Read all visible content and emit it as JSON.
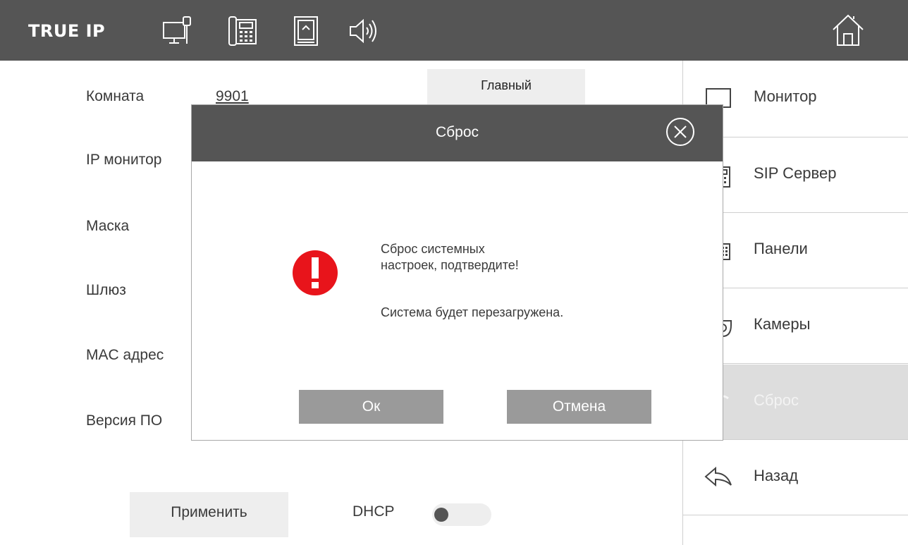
{
  "topbar": {
    "brand": "TRUE IP",
    "icons": [
      "monitor-icon",
      "phone-icon",
      "sd-card-icon",
      "speaker-icon"
    ],
    "home_icon": "home-icon",
    "background": "#555555"
  },
  "form": {
    "room_label": "Комната",
    "room_value": "9901",
    "main_button": "Главный",
    "ip_label": "IP монитор",
    "mask_label": "Маска",
    "gateway_label": "Шлюз",
    "mac_label": "MAC адрес",
    "firmware_label": "Версия ПО",
    "apply_button": "Применить",
    "dhcp_label": "DHCP",
    "dhcp_enabled": false
  },
  "menu": {
    "items": [
      {
        "label": "Монитор",
        "icon": "monitor-icon",
        "active": false
      },
      {
        "label": "SIP Сервер",
        "icon": "phone-keypad-icon",
        "active": false
      },
      {
        "label": "Панели",
        "icon": "panel-icon",
        "active": false
      },
      {
        "label": "Камеры",
        "icon": "camera-icon",
        "active": false
      },
      {
        "label": "Сброс",
        "icon": "reset-icon",
        "active": true
      },
      {
        "label": "Назад",
        "icon": "back-arrow-icon",
        "active": false
      }
    ]
  },
  "dialog": {
    "title": "Сброс",
    "message_line1": "Сброс системных",
    "message_line2": "настроек, подтвердите!",
    "message_line3": "Система будет перезагружена.",
    "ok_button": "Ок",
    "cancel_button": "Отмена",
    "warning_color": "#e8141b"
  }
}
